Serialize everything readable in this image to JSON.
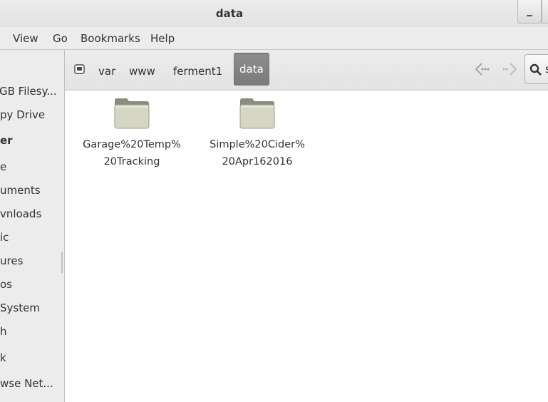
{
  "window": {
    "title": "data"
  },
  "menu": [
    "View",
    "Go",
    "Bookmarks",
    "Help"
  ],
  "sidebar": {
    "items": [
      {
        "label": "GB Filesy...",
        "kind": "device"
      },
      {
        "label": "py Drive",
        "kind": "device"
      },
      {
        "label": "er",
        "kind": "header"
      },
      {
        "label": "e",
        "kind": "place"
      },
      {
        "label": "uments",
        "kind": "place"
      },
      {
        "label": "vnloads",
        "kind": "place"
      },
      {
        "label": "ic",
        "kind": "place"
      },
      {
        "label": "ures",
        "kind": "place"
      },
      {
        "label": "os",
        "kind": "place"
      },
      {
        "label": "System",
        "kind": "place"
      },
      {
        "label": "h",
        "kind": "place"
      },
      {
        "label": "k",
        "kind": "network"
      },
      {
        "label": "wse Net...",
        "kind": "network"
      }
    ]
  },
  "pathbar": {
    "crumbs": [
      "var",
      "www",
      "ferment1",
      "data"
    ],
    "active_crumb": "data",
    "search_label": "s"
  },
  "files": [
    {
      "name": "Garage%20Temp%20Tracking",
      "line1": "Garage%20Temp%",
      "line2": "20Tracking",
      "type": "folder"
    },
    {
      "name": "Simple%20Cider%20Apr162016",
      "line1": "Simple%20Cider%",
      "line2": "20Apr162016",
      "type": "folder"
    }
  ],
  "colors": {
    "active_crumb_bg": "#838383",
    "folder_fill": "#d6d6c5",
    "folder_tab": "#8b8b7e"
  },
  "icons": [
    "drive-icon",
    "back-arrow-icon",
    "forward-arrow-icon",
    "search-icon",
    "folder-icon",
    "minimize-icon"
  ]
}
